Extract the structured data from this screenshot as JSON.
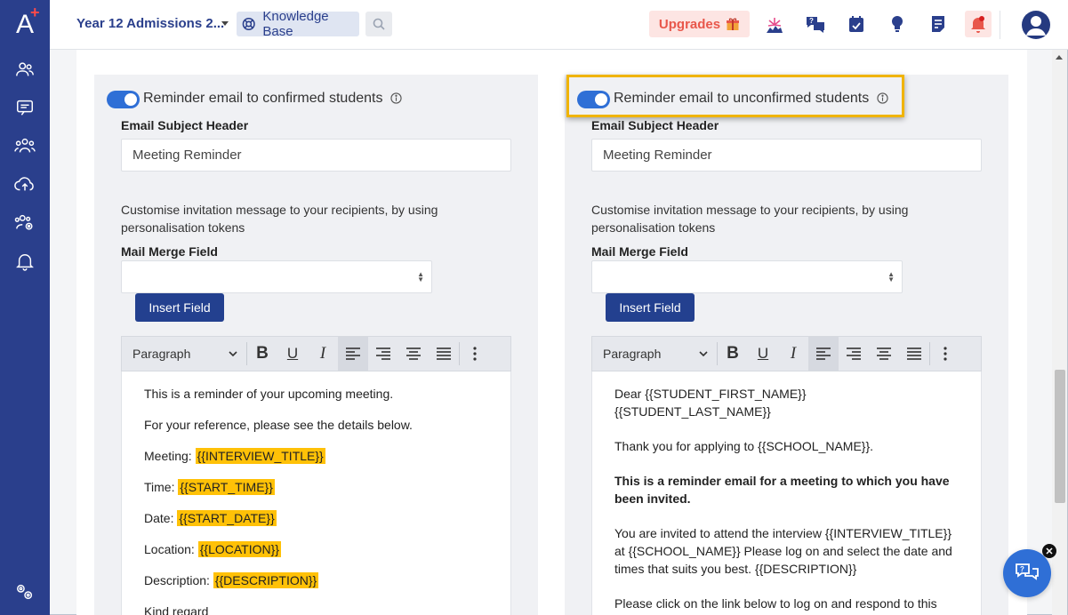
{
  "app": {
    "logo_letter": "A",
    "logo_plus": "+"
  },
  "header": {
    "title": "Year 12 Admissions 2...",
    "knowledge_base": "Knowledge Base",
    "upgrades": "Upgrades"
  },
  "sidebar": {
    "items": [
      "people-icon",
      "chat-icon",
      "group-icon",
      "cloud-upload-icon",
      "group-settings-icon",
      "bell-icon",
      "settings-icon"
    ]
  },
  "left_panel": {
    "toggle_label": "Reminder email to confirmed students",
    "subject_label": "Email Subject Header",
    "subject_value": "Meeting Reminder",
    "description": "Customise invitation message to your recipients, by using personalisation tokens",
    "merge_label": "Mail Merge Field",
    "insert_button": "Insert Field",
    "toolbar_paragraph": "Paragraph",
    "body": {
      "line1": "This is a reminder of your upcoming meeting.",
      "line2": "For your reference, please see the details below.",
      "meeting_label": "Meeting:",
      "meeting_token": "{{INTERVIEW_TITLE}}",
      "time_label": "Time:",
      "time_token": "{{START_TIME}}",
      "date_label": "Date:",
      "date_token": "{{START_DATE}}",
      "location_label": "Location:",
      "location_token": "{{LOCATION}}",
      "description_label": "Description:",
      "description_token": "{{DESCRIPTION}}",
      "closing": "Kind regard"
    }
  },
  "right_panel": {
    "toggle_label": "Reminder email to unconfirmed students",
    "subject_label": "Email Subject Header",
    "subject_value": "Meeting Reminder",
    "description": "Customise invitation message to your recipients, by using personalisation tokens",
    "merge_label": "Mail Merge Field",
    "insert_button": "Insert Field",
    "toolbar_paragraph": "Paragraph",
    "body": {
      "greeting": "Dear {{STUDENT_FIRST_NAME}} {{STUDENT_LAST_NAME}}",
      "thanks": "Thank you for applying to {{SCHOOL_NAME}}.",
      "bold_line": "This is a reminder email for a meeting to which you have been invited.",
      "invite": "You are invited to attend the interview {{INTERVIEW_TITLE}} at {{SCHOOL_NAME}} Please log on and select the date and times that suits you best. {{DESCRIPTION}}",
      "click": "Please click on the link below to log on and respond to this"
    }
  },
  "colors": {
    "sidebar": "#2a3f8c",
    "accent": "#2f6fd6",
    "highlight": "#f0b400",
    "token": "#ffc107"
  }
}
